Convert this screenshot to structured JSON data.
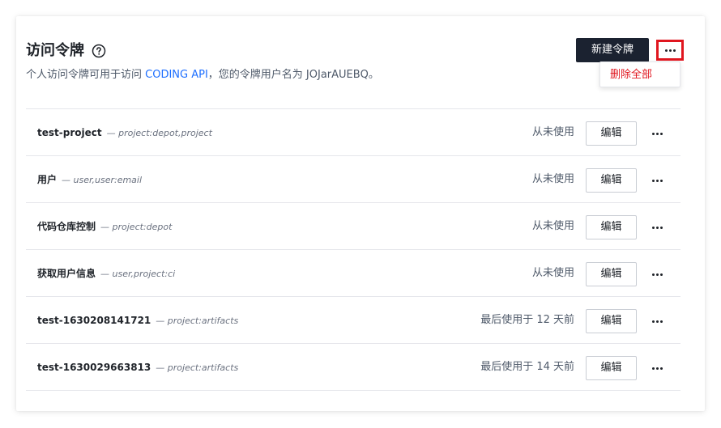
{
  "header": {
    "title": "访问令牌",
    "help_icon": "question-circle-icon",
    "subtitle_prefix": "个人访问令牌可用于访问 ",
    "subtitle_link": "CODING API",
    "subtitle_suffix": "，您的令牌用户名为 JOJarAUEBQ。",
    "new_button_label": "新建令牌",
    "more_icon": "more-horizontal-icon"
  },
  "dropdown": {
    "delete_all_label": "删除全部"
  },
  "tokens": [
    {
      "name": "test-project",
      "scope": "— project:depot,project",
      "status": "从未使用",
      "edit_label": "编辑"
    },
    {
      "name": "用户",
      "scope": "— user,user:email",
      "status": "从未使用",
      "edit_label": "编辑"
    },
    {
      "name": "代码仓库控制",
      "scope": "— project:depot",
      "status": "从未使用",
      "edit_label": "编辑"
    },
    {
      "name": "获取用户信息",
      "scope": "— user,project:ci",
      "status": "从未使用",
      "edit_label": "编辑"
    },
    {
      "name": "test-1630208141721",
      "scope": "— project:artifacts",
      "status": "最后使用于 12 天前",
      "edit_label": "编辑"
    },
    {
      "name": "test-1630029663813",
      "scope": "— project:artifacts",
      "status": "最后使用于 14 天前",
      "edit_label": "编辑"
    }
  ],
  "colors": {
    "primary_dark": "#1b2230",
    "link": "#1e6fff",
    "danger": "#e0161f",
    "border": "#e5e6eb"
  }
}
